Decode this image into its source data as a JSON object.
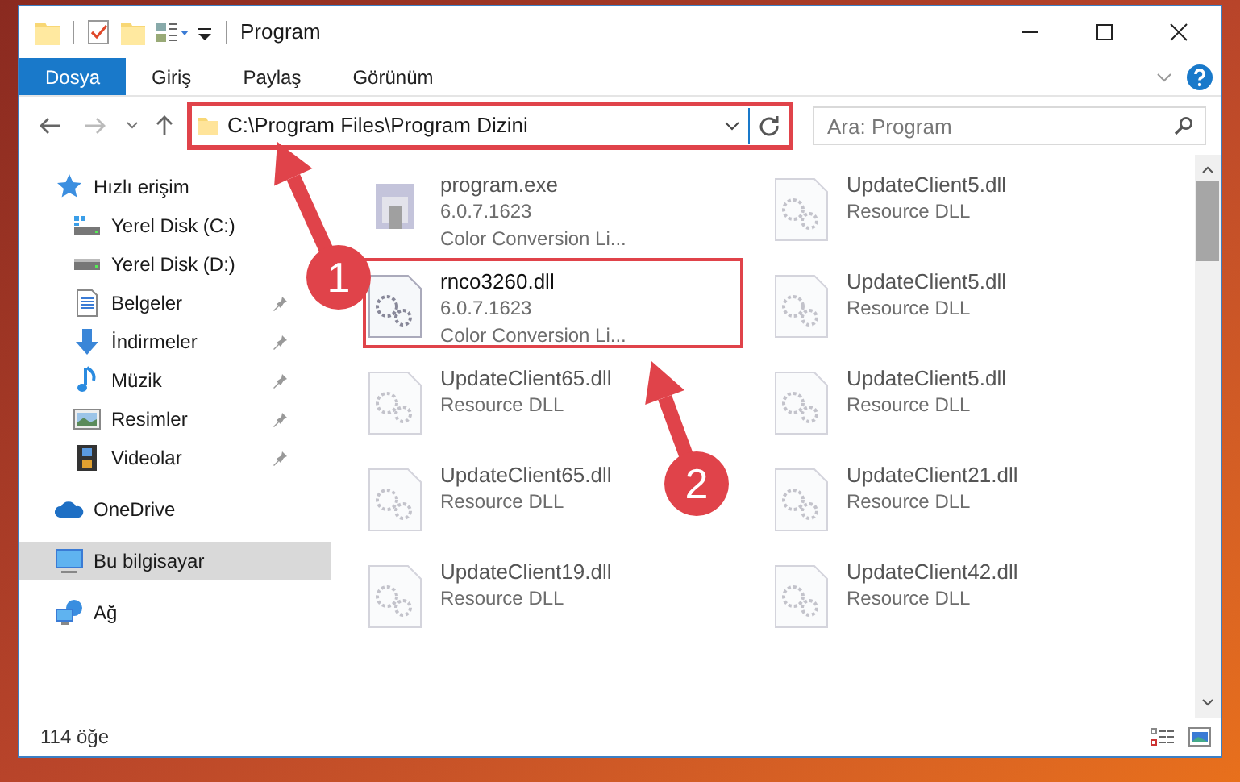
{
  "window": {
    "title": "Program"
  },
  "ribbon_tabs": [
    {
      "label": "Dosya",
      "selected": true
    },
    {
      "label": "Giriş",
      "selected": false
    },
    {
      "label": "Paylaş",
      "selected": false
    },
    {
      "label": "Görünüm",
      "selected": false
    }
  ],
  "address": {
    "value": "C:\\Program Files\\Program Dizini",
    "highlighted": true
  },
  "search": {
    "placeholder": "Ara: Program"
  },
  "sidebar": {
    "items": [
      {
        "label": "Hızlı erişim",
        "selected": false,
        "children": [
          {
            "label": "Yerel Disk (C:)",
            "pinned": false
          },
          {
            "label": "Yerel Disk (D:)",
            "pinned": false
          },
          {
            "label": "Belgeler",
            "pinned": true
          },
          {
            "label": "İndirmeler",
            "pinned": true
          },
          {
            "label": "Müzik",
            "pinned": true
          },
          {
            "label": "Resimler",
            "pinned": true
          },
          {
            "label": "Videolar",
            "pinned": true
          }
        ]
      },
      {
        "label": "OneDrive",
        "selected": false
      },
      {
        "label": "Bu bilgisayar",
        "selected": true
      },
      {
        "label": "Ağ",
        "selected": false
      }
    ]
  },
  "files": [
    {
      "name": "program.exe",
      "lines": [
        "6.0.7.1623",
        "Color Conversion Li..."
      ],
      "highlighted": false
    },
    {
      "name": "UpdateClient5.dll",
      "lines": [
        "Resource DLL"
      ],
      "highlighted": false
    },
    {
      "name": "rnco3260.dll",
      "lines": [
        "6.0.7.1623",
        "Color Conversion Li..."
      ],
      "highlighted": true
    },
    {
      "name": "UpdateClient5.dll",
      "lines": [
        "Resource DLL"
      ],
      "highlighted": false
    },
    {
      "name": "UpdateClient65.dll",
      "lines": [
        "Resource DLL"
      ],
      "highlighted": false
    },
    {
      "name": "UpdateClient5.dll",
      "lines": [
        "Resource DLL"
      ],
      "highlighted": false
    },
    {
      "name": "UpdateClient65.dll",
      "lines": [
        "Resource DLL"
      ],
      "highlighted": false
    },
    {
      "name": "UpdateClient21.dll",
      "lines": [
        "Resource DLL"
      ],
      "highlighted": false
    },
    {
      "name": "UpdateClient19.dll",
      "lines": [
        "Resource DLL"
      ],
      "highlighted": false
    },
    {
      "name": "UpdateClient42.dll",
      "lines": [
        "Resource DLL"
      ],
      "highlighted": false
    }
  ],
  "status_bar": {
    "count": "114 öğe"
  },
  "annotations": [
    {
      "label": "1"
    },
    {
      "label": "2"
    }
  ]
}
